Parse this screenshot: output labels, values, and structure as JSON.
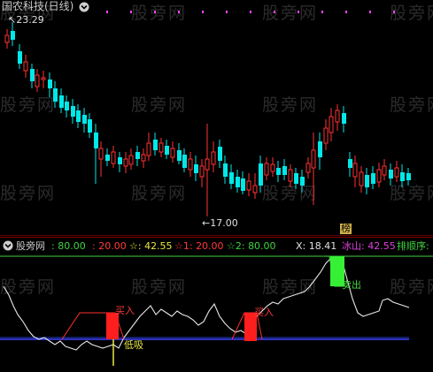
{
  "top_panel": {
    "title": "国农科技(日线)",
    "title_color": "#c8c8c8",
    "chevron": "chevron-down-icon",
    "dot_color": "#ff44ff",
    "high_label": "23.29",
    "low_label": "17.00",
    "rank_badge": "榜",
    "up_color": "#ff3232",
    "down_color": "#00e8e8"
  },
  "bottom_panel": {
    "name": "股旁网",
    "name_color": "#c8c8c8",
    "values": [
      {
        "text": ": 80.00",
        "color": "#3ed43e"
      },
      {
        "text": ": 20.00",
        "color": "#ff3a3a"
      },
      {
        "text": "☆: 42.55",
        "color": "#e8e840"
      },
      {
        "text": "☆1: 20.00",
        "color": "#ff3a3a"
      },
      {
        "text": "☆2: 80.00",
        "color": "#3ed43e"
      },
      {
        "text": "X: 18.41",
        "color": "#e0e0e0"
      },
      {
        "text": "冰山: 42.55",
        "color": "#e040e0"
      },
      {
        "text": "排顺序:",
        "color": "#3ed43e"
      }
    ],
    "signals": {
      "buy1": "买入",
      "dip": "低吸",
      "buy2": "买入",
      "sell": "卖出"
    },
    "level_80_color": "#3ed43e",
    "level_20_color": "#4040ff"
  },
  "watermark": "股旁网"
}
